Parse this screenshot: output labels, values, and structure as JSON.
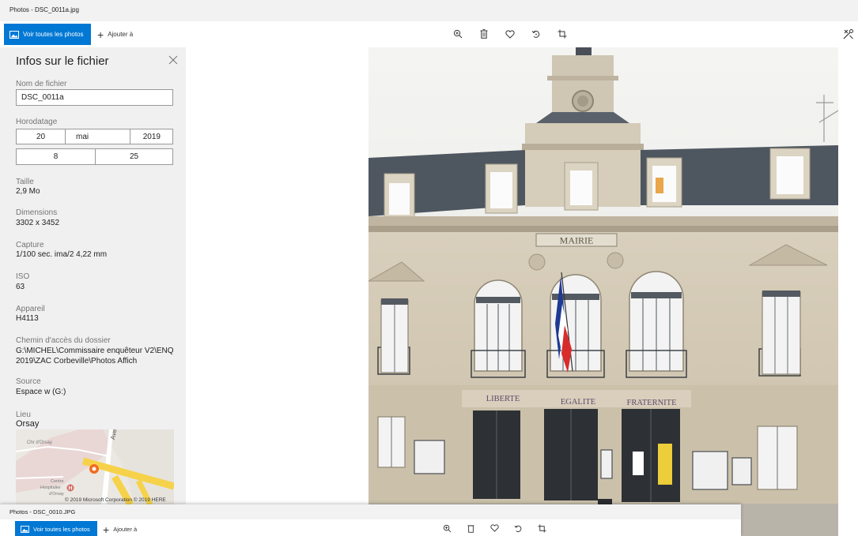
{
  "window": {
    "title": "Photos - DSC_0011a.jpg",
    "toolbar": {
      "view_all_label": "Voir toutes les photos",
      "add_to_label": "Ajouter à"
    }
  },
  "info_panel": {
    "title": "Infos sur le fichier",
    "filename": {
      "label": "Nom de fichier",
      "value": "DSC_0011a"
    },
    "timestamp": {
      "label": "Horodatage",
      "day": "20",
      "month": "mai",
      "year": "2019",
      "hour": "8",
      "minute": "25"
    },
    "size": {
      "label": "Taille",
      "value": "2,9 Mo"
    },
    "dimensions": {
      "label": "Dimensions",
      "value": "3302 x 3452"
    },
    "capture": {
      "label": "Capture",
      "value": "1/100 sec. ima/2 4,22 mm"
    },
    "iso": {
      "label": "ISO",
      "value": "63"
    },
    "device": {
      "label": "Appareil",
      "value": "H4113"
    },
    "folder_path": {
      "label": "Chemin d'accès du dossier",
      "line1": "G:\\MICHEL\\Commissaire enquêteur V2\\ENQ",
      "line2": "2019\\ZAC Corbeville\\Photos Affich"
    },
    "source": {
      "label": "Source",
      "value": "Espace w (G:)"
    },
    "location": {
      "label": "Lieu",
      "value": "Orsay"
    },
    "map": {
      "street_label": "Avenue du",
      "place_label": "Chr d'Orsay",
      "hospital_line1": "Centre",
      "hospital_line2": "Hospitalier",
      "hospital_line3": "d'Orsay",
      "copyright": "© 2019 Microsoft Corporation  © 2019 HERE"
    }
  },
  "photo": {
    "sign_mairie": "MAIRIE",
    "motto_1": "LIBERTE",
    "motto_2": "EGALITE",
    "motto_3": "FRATERNITE"
  },
  "second_window": {
    "title": "Photos - DSC_0010.JPG",
    "view_all_label": "Voir toutes les photos",
    "add_to_label": "Ajouter à"
  },
  "colors": {
    "accent": "#0078d4",
    "panel_bg": "#f0f0f0",
    "titlebar_bg": "#f2f2f2",
    "map_pin": "#f26b21"
  },
  "icons": {
    "view_all": "photos-icon",
    "add": "plus-icon",
    "zoom": "zoom-in-icon",
    "delete": "trash-icon",
    "favorite": "heart-icon",
    "rotate": "rotate-icon",
    "crop": "crop-icon",
    "edit": "edit-create-icon",
    "close": "close-icon",
    "map_pin": "map-pin-icon",
    "hospital": "hospital-icon"
  }
}
